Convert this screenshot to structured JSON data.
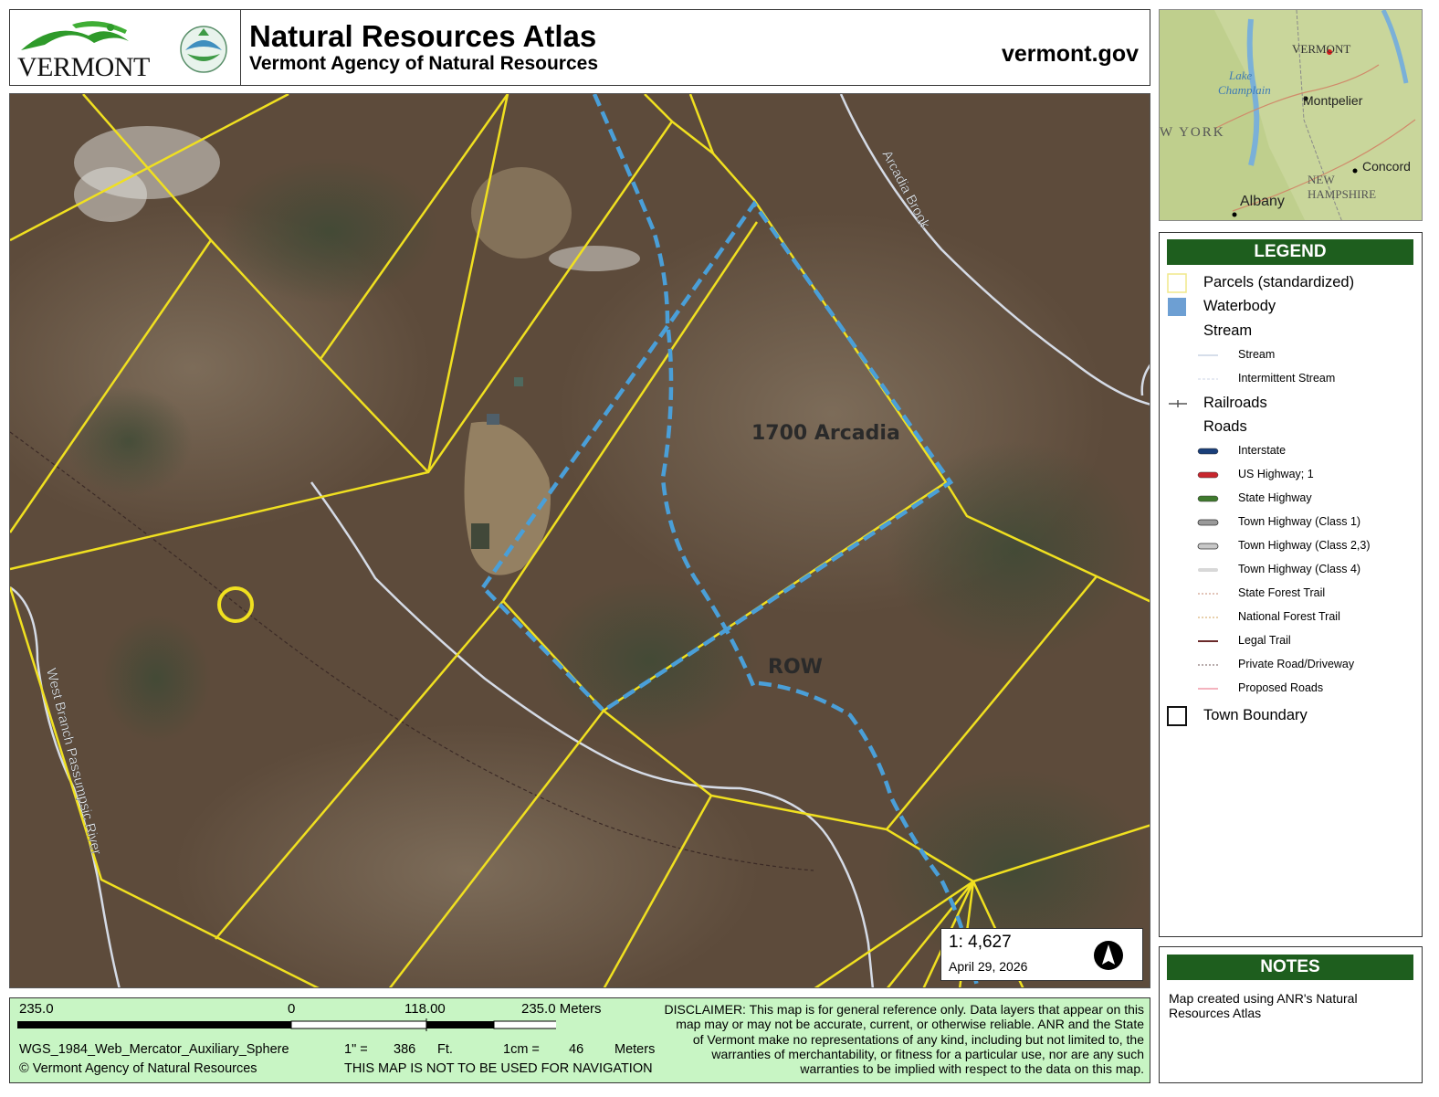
{
  "header": {
    "logo_text": "VERMONT",
    "title": "Natural Resources Atlas",
    "subtitle": "Vermont Agency of Natural Resources",
    "site": "vermont.gov"
  },
  "map": {
    "labels": {
      "parcel": "1700 Arcadia",
      "row": "ROW",
      "brook": "Arcadia Brook",
      "river": "West Branch Passumpsic River"
    },
    "colors": {
      "parcel_line": "#f0e020",
      "proposed_line": "#4a9fd8",
      "stream": "#cfd6e2",
      "imagery_base": "#5b4a3a"
    }
  },
  "inset": {
    "labels": [
      "VERMONT",
      "Lake Champlain",
      "Montpelier",
      "NEW YORK",
      "Concord",
      "NEW HAMPSHIRE",
      "Albany"
    ]
  },
  "legend": {
    "title": "LEGEND",
    "items": [
      {
        "label": "Parcels (standardized)",
        "size": "big",
        "swatch": "parcel"
      },
      {
        "label": "Waterbody",
        "size": "big",
        "swatch": "waterbody"
      },
      {
        "label": "Stream",
        "size": "big",
        "swatch": "none"
      },
      {
        "label": "Stream",
        "size": "small",
        "swatch": "stream"
      },
      {
        "label": "Intermittent Stream",
        "size": "small",
        "swatch": "intermittent"
      },
      {
        "label": "Railroads",
        "size": "big",
        "swatch": "railroad"
      },
      {
        "label": "Roads",
        "size": "big",
        "swatch": "none"
      },
      {
        "label": "Interstate",
        "size": "small",
        "swatch": "interstate"
      },
      {
        "label": "US Highway; 1",
        "size": "small",
        "swatch": "ushwy"
      },
      {
        "label": "State Highway",
        "size": "small",
        "swatch": "statehwy"
      },
      {
        "label": "Town Highway (Class 1)",
        "size": "small",
        "swatch": "class1"
      },
      {
        "label": "Town Highway (Class 2,3)",
        "size": "small",
        "swatch": "class23"
      },
      {
        "label": "Town Highway (Class 4)",
        "size": "small",
        "swatch": "class4"
      },
      {
        "label": "State Forest Trail",
        "size": "small",
        "swatch": "sftrail"
      },
      {
        "label": "National Forest Trail",
        "size": "small",
        "swatch": "nftrail"
      },
      {
        "label": "Legal Trail",
        "size": "small",
        "swatch": "legaltrail"
      },
      {
        "label": "Private Road/Driveway",
        "size": "small",
        "swatch": "private"
      },
      {
        "label": "Proposed Roads",
        "size": "small",
        "swatch": "proposed"
      },
      {
        "label": "Town Boundary",
        "size": "big",
        "swatch": "townbound"
      }
    ]
  },
  "notes": {
    "title": "NOTES",
    "text": "Map created using ANR's Natural Resources Atlas"
  },
  "scale": {
    "ratio": "1:  4,627",
    "date": "April 29, 2026"
  },
  "footer": {
    "bar_left": "235.0",
    "bar_zero": "0",
    "bar_mid": "118.00",
    "bar_right": "235.0 Meters",
    "projection": "WGS_1984_Web_Mercator_Auxiliary_Sphere",
    "copyright": "© Vermont Agency of Natural Resources",
    "inch_label": "1\" =",
    "inch_value": "386",
    "inch_unit": "Ft.",
    "cm_label": "1cm =",
    "cm_value": "46",
    "cm_unit": "Meters",
    "nav_warning": "THIS MAP IS NOT TO BE USED FOR NAVIGATION",
    "disclaimer": "DISCLAIMER: This map is for general reference only. Data layers that appear on this map may or may not be accurate, current, or otherwise reliable. ANR and the State of Vermont make no representations of any kind, including but not limited to, the warranties of merchantability, or fitness for a particular use, nor are any such warranties to be implied with respect to the data on this map."
  }
}
